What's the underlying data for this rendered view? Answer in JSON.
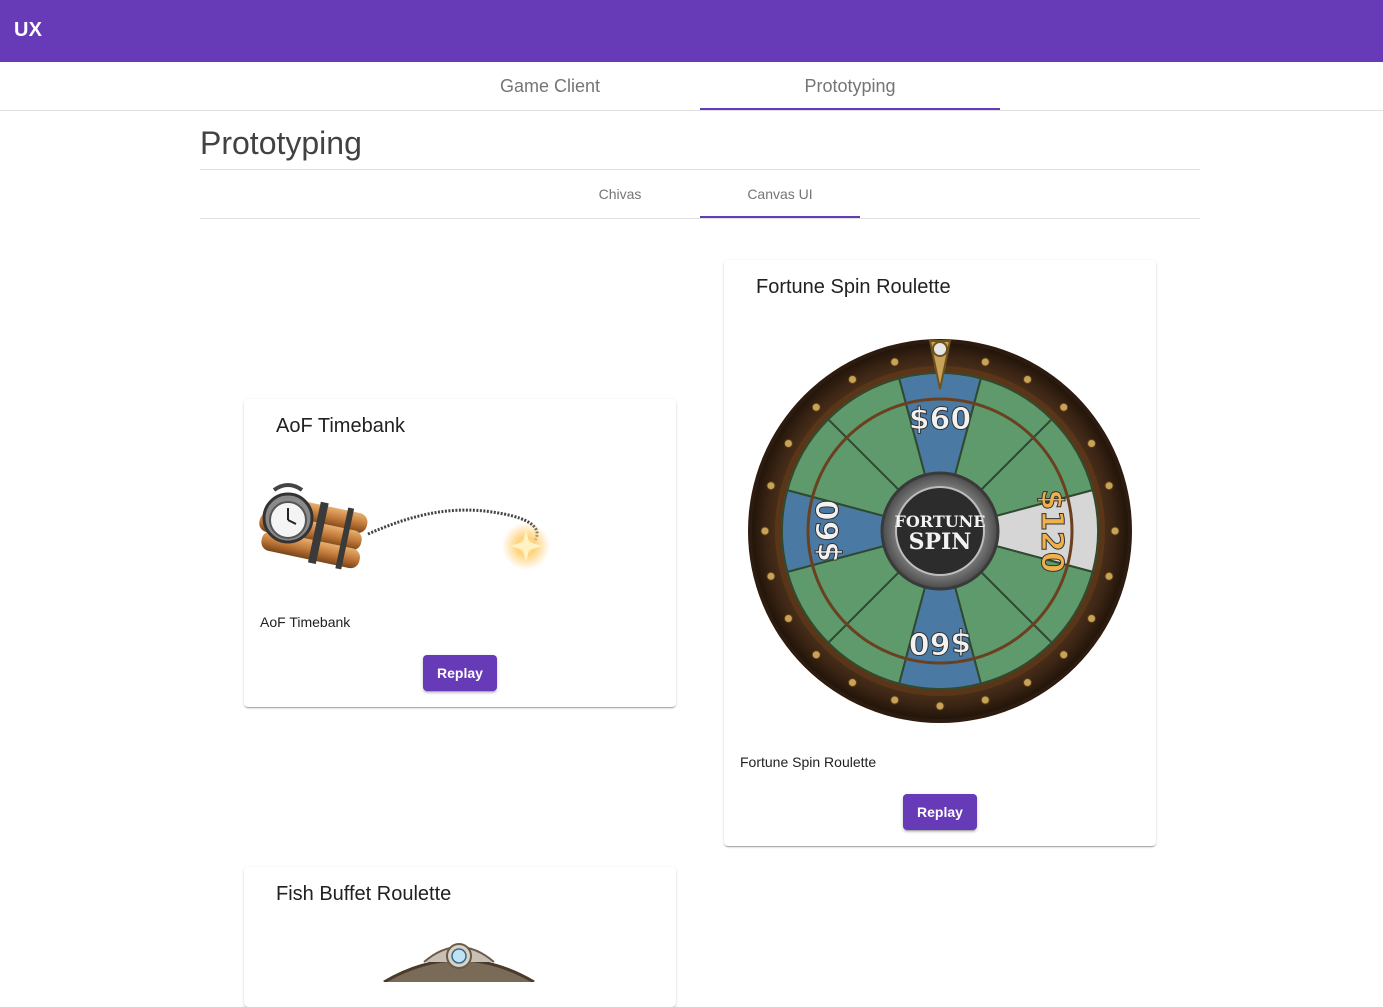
{
  "app": {
    "brand": "UX"
  },
  "top_tabs": [
    {
      "label": "Game Client",
      "active": false
    },
    {
      "label": "Prototyping",
      "active": true
    }
  ],
  "page": {
    "title": "Prototyping"
  },
  "sub_tabs": [
    {
      "label": "Chivas",
      "active": false
    },
    {
      "label": "Canvas UI",
      "active": true
    }
  ],
  "cards": {
    "aof": {
      "title": "AoF Timebank",
      "caption": "AoF Timebank",
      "button": "Replay",
      "icon": "timebomb-icon"
    },
    "fortune": {
      "title": "Fortune Spin Roulette",
      "caption": "Fortune Spin Roulette",
      "button": "Replay",
      "icon": "roulette-wheel-icon",
      "wheel": {
        "center_line1": "FORTUNE",
        "center_line2": "SPIN",
        "prize_small": "$60",
        "prize_big": "$120"
      }
    },
    "fish": {
      "title": "Fish Buffet Roulette",
      "icon": "ornate-wheel-top-icon"
    }
  },
  "colors": {
    "primary": "#673ab7",
    "wheel_blue": "#4a7aa3",
    "wheel_green": "#5e9a6c",
    "wheel_wood": "#7a4a22"
  }
}
